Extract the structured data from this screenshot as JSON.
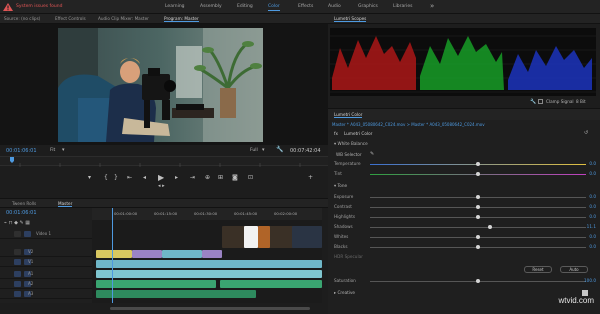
{
  "topbar": {
    "warning_text": "System issues found",
    "workspaces": [
      "Learning",
      "Assembly",
      "Editing",
      "Color",
      "Effects",
      "Audio",
      "Graphics",
      "Libraries"
    ],
    "active_workspace": "Color",
    "overflow": "»"
  },
  "source_panel": {
    "tabs": [
      "Source: (no clips)",
      "Effect Controls",
      "Audio Clip Mixer: Master",
      "Program: Master"
    ],
    "active_tab": "Program: Master"
  },
  "program_monitor": {
    "timecode": "00:01:06:01",
    "fit": "Fit",
    "quality": "Full",
    "duration": "00:07:42:04"
  },
  "transport": {
    "buttons": [
      "mark-in",
      "mark-out",
      "go-to-in",
      "step-back",
      "play",
      "step-forward",
      "go-to-out",
      "insert",
      "overwrite",
      "lift",
      "extract",
      "export-frame",
      "button-editor"
    ]
  },
  "timeline": {
    "tabs": [
      "Tween Rolls",
      "Master"
    ],
    "active_tab": "Master",
    "timecode": "00:01:06:01",
    "ruler_labels": [
      "00:01:00:00",
      "00:01:15:00",
      "00:01:30:00",
      "00:01:45:00",
      "00:02:00:00"
    ],
    "tracks": [
      {
        "id": "V3",
        "type": "video"
      },
      {
        "id": "V2",
        "type": "video"
      },
      {
        "id": "V1",
        "type": "video",
        "name": "Video 1"
      },
      {
        "id": "A1",
        "type": "audio"
      },
      {
        "id": "A2",
        "type": "audio"
      },
      {
        "id": "A3",
        "type": "audio"
      }
    ],
    "track_label_v1": "Video 1"
  },
  "lumetri_scopes": {
    "title": "Lumetri Scopes",
    "clamp_signal": "Clamp Signal",
    "bit_depth": "8 Bit"
  },
  "lumetri_color": {
    "title": "Lumetri Color",
    "clip_path": "Master * A043_05080642_C024.mov  >  Master * A043_05080642_C024.mov",
    "effect_name": "Lumetri Color",
    "sections": {
      "white_balance": "White Balance",
      "tone": "Tone"
    },
    "wb_selector": "WB Selector",
    "controls": [
      {
        "name": "Temperature",
        "value": "0.0",
        "position": 0.5,
        "track": "temp"
      },
      {
        "name": "Tint",
        "value": "0.0",
        "position": 0.5,
        "track": "tint"
      }
    ],
    "tone_controls": [
      {
        "name": "Exposure",
        "value": "0.0",
        "position": 0.5
      },
      {
        "name": "Contrast",
        "value": "0.0",
        "position": 0.5
      },
      {
        "name": "Highlights",
        "value": "0.0",
        "position": 0.5
      },
      {
        "name": "Shadows",
        "value": "11.1",
        "position": 0.55
      },
      {
        "name": "Whites",
        "value": "0.0",
        "position": 0.5
      },
      {
        "name": "Blacks",
        "value": "0.0",
        "position": 0.5
      }
    ],
    "hdr_specular": "HDR Specular",
    "reset_label": "Reset",
    "auto_label": "Auto",
    "saturation_label": "Saturation",
    "saturation_value": "100.0",
    "creative_label": "Creative"
  },
  "watermark": "wtvid.com",
  "colors": {
    "accent": "#4e9ae0",
    "warning": "#e05555",
    "clip_video": "#6fb7c8",
    "clip_audio": "#3aa571",
    "clip_yellow": "#d8c760",
    "clip_purple": "#9a83c4"
  }
}
